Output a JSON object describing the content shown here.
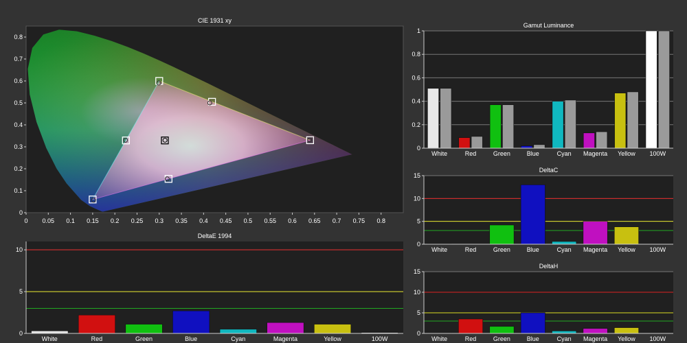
{
  "chart_data": [
    {
      "type": "scatter",
      "title": "CIE 1931 xy",
      "xlabel": "",
      "ylabel": "",
      "xlim": [
        0,
        0.85
      ],
      "ylim": [
        0,
        0.85
      ],
      "xticks": [
        "0",
        "0.05",
        "0.1",
        "0.15",
        "0.2",
        "0.25",
        "0.3",
        "0.35",
        "0.4",
        "0.45",
        "0.5",
        "0.55",
        "0.6",
        "0.65",
        "0.7",
        "0.75",
        "0.8"
      ],
      "yticks": [
        "0",
        "0.1",
        "0.2",
        "0.3",
        "0.4",
        "0.5",
        "0.6",
        "0.7",
        "0.8"
      ],
      "grid": false,
      "target_gamut": [
        {
          "name": "Red",
          "x": 0.64,
          "y": 0.33
        },
        {
          "name": "Green",
          "x": 0.3,
          "y": 0.6
        },
        {
          "name": "Blue",
          "x": 0.15,
          "y": 0.06
        },
        {
          "name": "Cyan",
          "x": 0.225,
          "y": 0.329
        },
        {
          "name": "Magenta",
          "x": 0.321,
          "y": 0.154
        },
        {
          "name": "Yellow",
          "x": 0.419,
          "y": 0.505
        },
        {
          "name": "White",
          "x": 0.3127,
          "y": 0.329
        }
      ],
      "measured": [
        {
          "name": "Red",
          "x": 0.639,
          "y": 0.331
        },
        {
          "name": "Green",
          "x": 0.299,
          "y": 0.591
        },
        {
          "name": "Blue",
          "x": 0.152,
          "y": 0.057
        },
        {
          "name": "Cyan",
          "x": 0.224,
          "y": 0.33
        },
        {
          "name": "Magenta",
          "x": 0.318,
          "y": 0.154
        },
        {
          "name": "Yellow",
          "x": 0.414,
          "y": 0.5
        },
        {
          "name": "White",
          "x": 0.313,
          "y": 0.33
        }
      ]
    },
    {
      "type": "bar",
      "title": "Gamut Luminance",
      "categories": [
        "White",
        "Red",
        "Green",
        "Blue",
        "Cyan",
        "Magenta",
        "Yellow",
        "100W"
      ],
      "series": [
        {
          "values": [
            0.51,
            0.09,
            0.37,
            0.02,
            0.4,
            0.13,
            0.47,
            1.0
          ]
        },
        {
          "values": [
            0.51,
            0.1,
            0.37,
            0.03,
            0.41,
            0.14,
            0.48,
            1.0
          ]
        }
      ],
      "ylim": [
        0,
        1
      ],
      "yticks": [
        "0",
        "0.2",
        "0.4",
        "0.6",
        "0.8",
        "1"
      ],
      "grid": true
    },
    {
      "type": "bar",
      "title": "DeltaC",
      "categories": [
        "White",
        "Red",
        "Green",
        "Blue",
        "Cyan",
        "Magenta",
        "Yellow",
        "100W"
      ],
      "values": [
        0.1,
        0.0,
        4.2,
        13.0,
        0.6,
        5.0,
        3.8,
        0.0
      ],
      "ylim": [
        0,
        15
      ],
      "yticks": [
        "0",
        "5",
        "10",
        "15"
      ],
      "reference_lines": [
        {
          "value": 10,
          "color": "#dd2222"
        },
        {
          "value": 5,
          "color": "#dddd22"
        },
        {
          "value": 3,
          "color": "#22aa22"
        }
      ],
      "grid": true
    },
    {
      "type": "bar",
      "title": "DeltaE 1994",
      "categories": [
        "White",
        "Red",
        "Green",
        "Blue",
        "Cyan",
        "Magenta",
        "Yellow",
        "100W"
      ],
      "values": [
        0.3,
        2.2,
        1.1,
        2.7,
        0.5,
        1.3,
        1.1,
        0.1
      ],
      "ylim": [
        0,
        11
      ],
      "yticks": [
        "0",
        "5",
        "10"
      ],
      "reference_lines": [
        {
          "value": 10,
          "color": "#dd2222"
        },
        {
          "value": 5,
          "color": "#dddd22"
        },
        {
          "value": 3,
          "color": "#22aa22"
        }
      ],
      "grid": true
    },
    {
      "type": "bar",
      "title": "DeltaH",
      "categories": [
        "White",
        "Red",
        "Green",
        "Blue",
        "Cyan",
        "Magenta",
        "Yellow",
        "100W"
      ],
      "values": [
        0.1,
        3.5,
        1.7,
        5.0,
        0.6,
        1.2,
        1.4,
        0.0
      ],
      "ylim": [
        0,
        15
      ],
      "yticks": [
        "0",
        "5",
        "10",
        "15"
      ],
      "reference_lines": [
        {
          "value": 10,
          "color": "#dd2222"
        },
        {
          "value": 5,
          "color": "#dddd22"
        },
        {
          "value": 3,
          "color": "#22aa22"
        }
      ],
      "grid": true
    }
  ],
  "colors": {
    "background": "#333333",
    "plot_bg": "#202020",
    "grid": "#777777",
    "text": "#ffffff",
    "axis": "#cccccc",
    "bars": {
      "White": "#e8e8e8",
      "Red": "#d11010",
      "Green": "#10c010",
      "Blue": "#1010c0",
      "Cyan": "#10b8c0",
      "Magenta": "#c010c0",
      "Yellow": "#c8c010",
      "100W": "#ffffff",
      "target": "#9a9a9a"
    }
  }
}
